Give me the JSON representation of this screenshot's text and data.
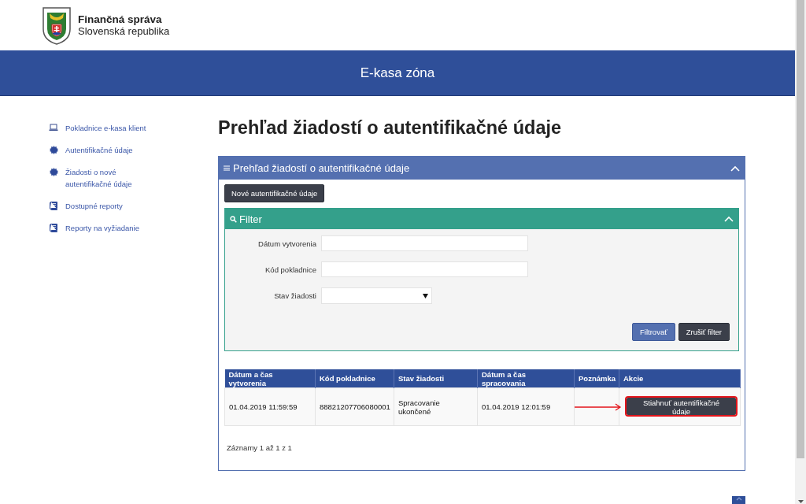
{
  "header": {
    "title": "Finančná správa",
    "subtitle": "Slovenská republika"
  },
  "banner": {
    "title": "E-kasa zóna"
  },
  "sidebar": {
    "items": [
      {
        "label": "Pokladnice e-kasa klient",
        "kind": "laptop"
      },
      {
        "label": "Autentifikačné údaje",
        "kind": "seal"
      },
      {
        "label": "Žiadosti o nové autentifikačné údaje",
        "kind": "seal"
      },
      {
        "label": "Dostupné reporty",
        "kind": "book"
      },
      {
        "label": "Reporty na vyžiadanie",
        "kind": "book"
      }
    ]
  },
  "page_title": "Prehľad žiadostí o autentifikačné údaje",
  "panel": {
    "title": "Prehľad žiadostí o autentifikačné údaje",
    "expanded": true,
    "new_button": "Nové autentifikačné údaje",
    "filter": {
      "title": "Filter",
      "expanded": true,
      "fields": [
        {
          "label": "Dátum vytvorenia",
          "kind": "text"
        },
        {
          "label": "Kód pokladnice",
          "kind": "text"
        },
        {
          "label": "Stav žiadosti",
          "kind": "select"
        }
      ],
      "buttons": [
        {
          "label": "Filtrovať",
          "kind": "primary"
        },
        {
          "label": "Zrušiť filter",
          "kind": "secondary"
        }
      ]
    },
    "table": {
      "columns": [
        "Dátum a čas vytvorenia",
        "Kód pokladnice",
        "Stav žiadosti",
        "Dátum a čas spracovania",
        "Poznámka",
        "Akcie"
      ],
      "rows": [
        {
          "created": "01.04.2019 11:59:59",
          "cash_register": "88821207706080001",
          "status": "Spracovanie ukončené",
          "processed": "01.04.2019 12:01:59",
          "action": "Stiahnuť autentifikačné údaje",
          "highlighted": true
        }
      ]
    },
    "record_count": "Záznamy 1 až 1 z 1"
  }
}
